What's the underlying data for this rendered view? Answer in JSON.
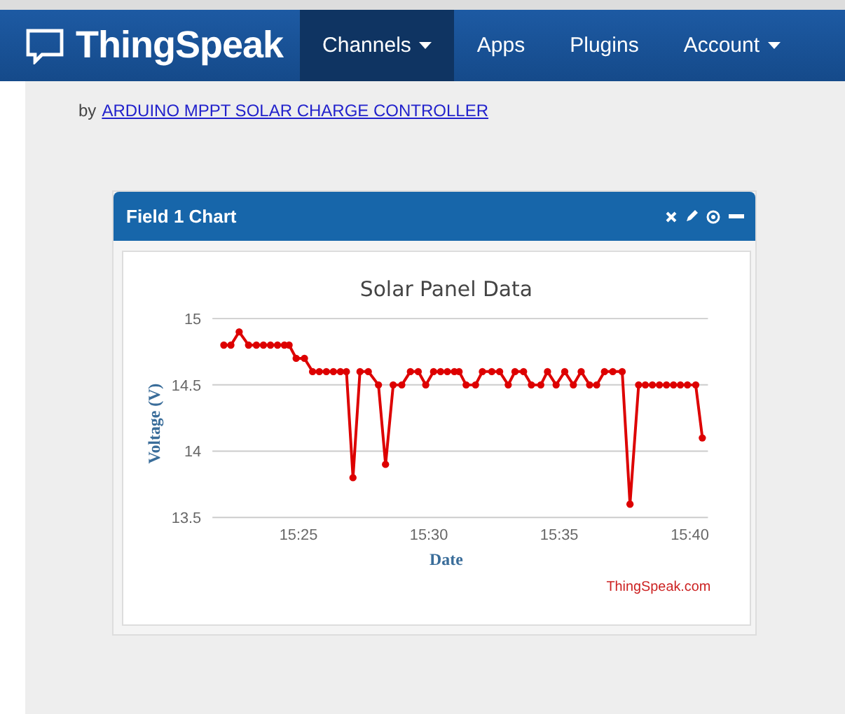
{
  "navbar": {
    "brand": "ThingSpeak",
    "items": [
      {
        "label": "Channels",
        "selected": true,
        "has_menu": true
      },
      {
        "label": "Apps",
        "selected": false,
        "has_menu": false
      },
      {
        "label": "Plugins",
        "selected": false,
        "has_menu": false
      },
      {
        "label": "Account",
        "selected": false,
        "has_menu": true
      }
    ]
  },
  "author": {
    "prefix": "by",
    "link": "ARDUINO MPPT SOLAR CHARGE CONTROLLER"
  },
  "panel": {
    "title": "Field 1 Chart",
    "credit": "ThingSpeak.com",
    "chart_data": {
      "type": "line",
      "title": "Solar Panel Data",
      "xlabel": "Date",
      "ylabel": "Voltage (V)",
      "xlim": [
        15.3617,
        15.6783
      ],
      "ylim": [
        13.5,
        15
      ],
      "xticks": [
        {
          "value": 15.4167,
          "label": "15:25"
        },
        {
          "value": 15.5,
          "label": "15:30"
        },
        {
          "value": 15.5833,
          "label": "15:35"
        },
        {
          "value": 15.6667,
          "label": "15:40"
        }
      ],
      "yticks": [
        {
          "value": 13.5,
          "label": "13.5"
        },
        {
          "value": 14,
          "label": "14"
        },
        {
          "value": 14.5,
          "label": "14.5"
        },
        {
          "value": 15,
          "label": "15"
        }
      ],
      "x": [
        15.369,
        15.3735,
        15.3788,
        15.3848,
        15.3898,
        15.3943,
        15.3988,
        15.4033,
        15.4077,
        15.4107,
        15.4152,
        15.4205,
        15.4257,
        15.43,
        15.4345,
        15.439,
        15.4435,
        15.4473,
        15.4515,
        15.456,
        15.4613,
        15.4678,
        15.4723,
        15.4772,
        15.4827,
        15.4882,
        15.4932,
        15.498,
        15.503,
        15.5075,
        15.5118,
        15.5163,
        15.5193,
        15.5238,
        15.5298,
        15.5342,
        15.5402,
        15.5452,
        15.5507,
        15.555,
        15.5605,
        15.5655,
        15.5715,
        15.5758,
        15.5813,
        15.5868,
        15.5923,
        15.5973,
        15.6027,
        15.6072,
        15.6122,
        15.6175,
        15.6235,
        15.6285,
        15.634,
        15.6383,
        15.6428,
        15.6473,
        15.6518,
        15.6563,
        15.6607,
        15.6652,
        15.6705,
        15.6747
      ],
      "series": [
        {
          "color": "#dd0000",
          "marker": "circle",
          "values": [
            14.8,
            14.8,
            14.9,
            14.8,
            14.8,
            14.8,
            14.8,
            14.8,
            14.8,
            14.8,
            14.7,
            14.7,
            14.6,
            14.6,
            14.6,
            14.6,
            14.6,
            14.6,
            13.8,
            14.6,
            14.6,
            14.5,
            13.9,
            14.5,
            14.5,
            14.6,
            14.6,
            14.5,
            14.6,
            14.6,
            14.6,
            14.6,
            14.6,
            14.5,
            14.5,
            14.6,
            14.6,
            14.6,
            14.5,
            14.6,
            14.6,
            14.5,
            14.5,
            14.6,
            14.5,
            14.6,
            14.5,
            14.6,
            14.5,
            14.5,
            14.6,
            14.6,
            14.6,
            13.6,
            14.5,
            14.5,
            14.5,
            14.5,
            14.5,
            14.5,
            14.5,
            14.5,
            14.5,
            14.1
          ]
        }
      ]
    }
  }
}
